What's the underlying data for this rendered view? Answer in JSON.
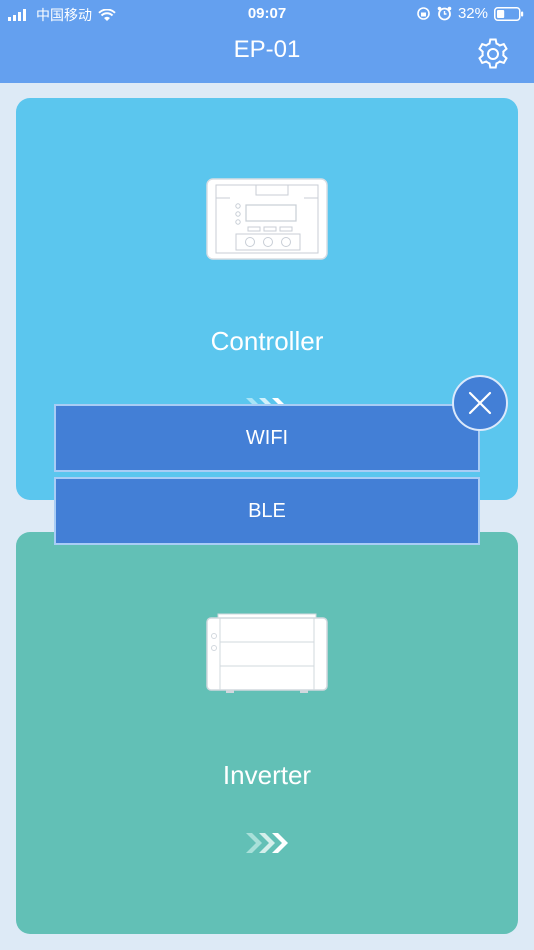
{
  "status_bar": {
    "carrier": "中国移动",
    "time": "09:07",
    "battery": "32%"
  },
  "nav": {
    "title": "EP-01",
    "settings_icon": "gear-icon"
  },
  "cards": [
    {
      "label": "Controller",
      "icon": "controller-device-icon",
      "arrow_icon": "triple-chevron-right-icon"
    },
    {
      "label": "Inverter",
      "icon": "inverter-device-icon",
      "arrow_icon": "triple-chevron-right-icon"
    }
  ],
  "popup": {
    "options": [
      "WIFI",
      "BLE"
    ],
    "close_icon": "close-icon"
  },
  "colors": {
    "nav": "#64a0ef",
    "background": "#ddeaf6",
    "controller_card": "#5bc6ee",
    "inverter_card": "#62c0b6",
    "popup_button": "#437fd6"
  }
}
